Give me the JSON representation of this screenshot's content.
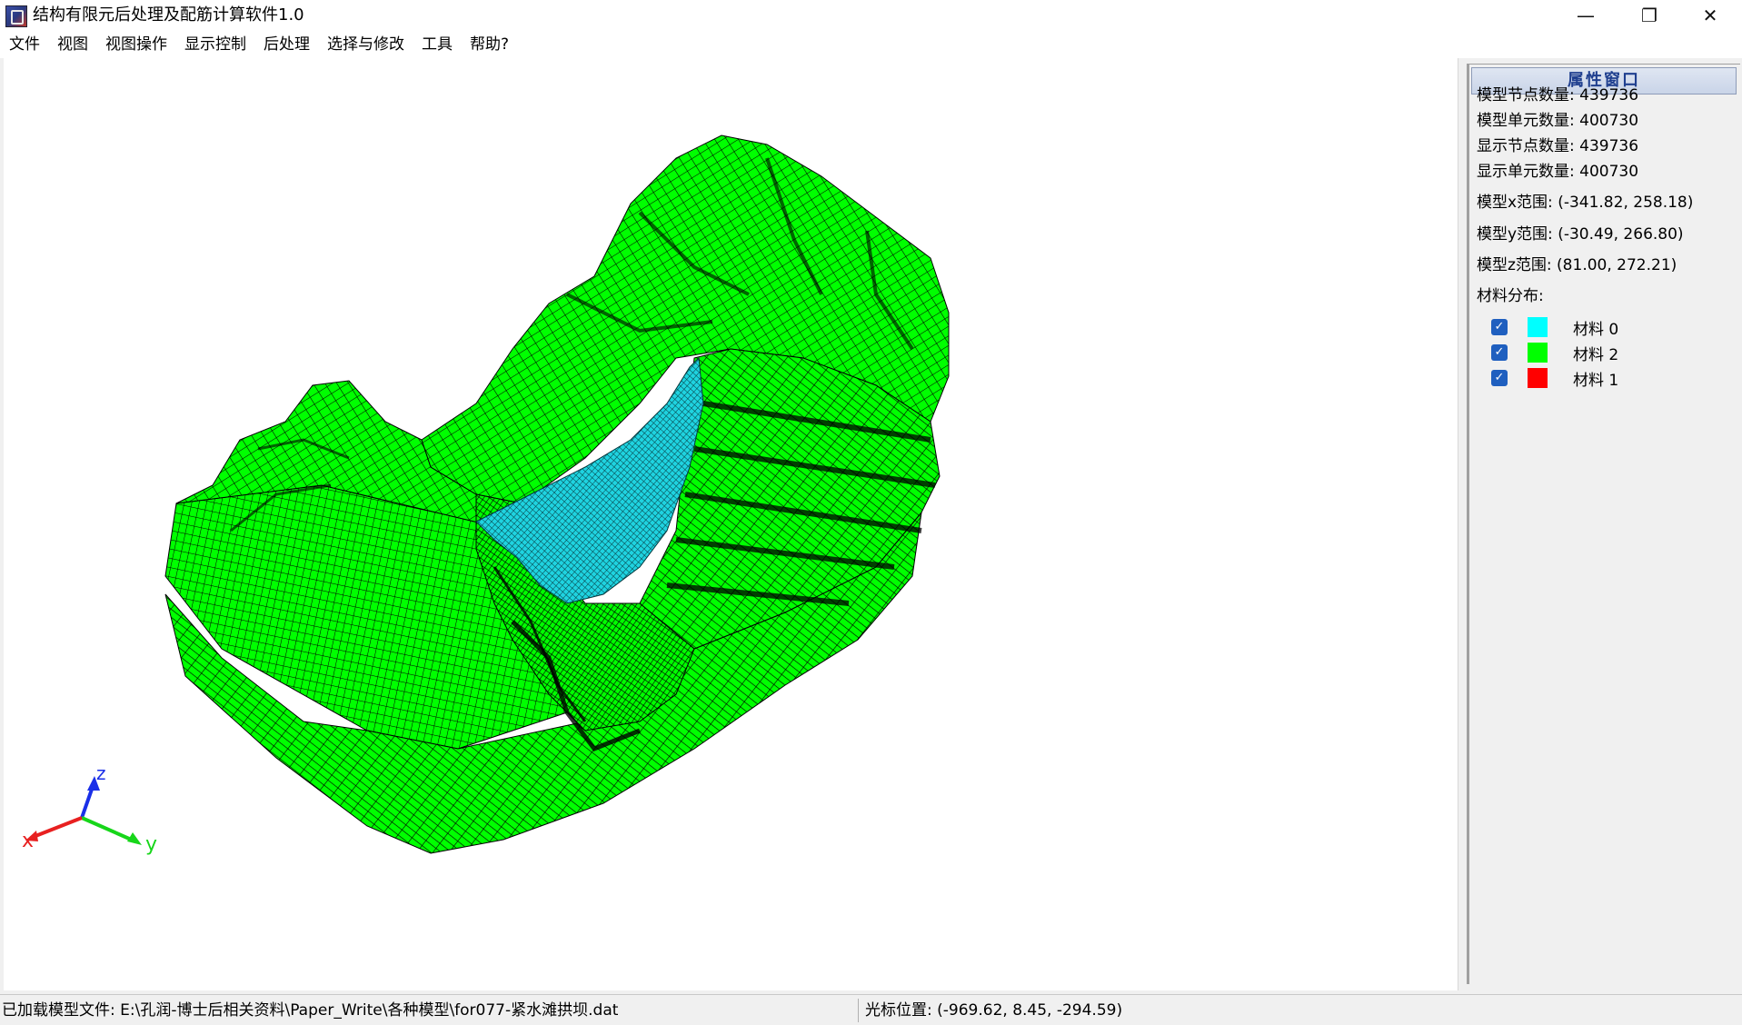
{
  "window": {
    "title": "结构有限元后处理及配筋计算软件1.0",
    "minimize_glyph": "—",
    "maximize_glyph": "❐",
    "close_glyph": "✕"
  },
  "menu": [
    "文件",
    "视图",
    "视图操作",
    "显示控制",
    "后处理",
    "选择与修改",
    "工具",
    "帮助?"
  ],
  "axes": {
    "x_label": "x",
    "y_label": "y",
    "z_label": "z"
  },
  "panel": {
    "title": "属性窗口",
    "props": [
      "模型节点数量: 439736",
      "模型单元数量: 400730",
      "显示节点数量: 439736",
      "显示单元数量: 400730",
      "模型x范围: (-341.82, 258.18)",
      "模型y范围: (-30.49, 266.80)",
      "模型z范围: (81.00, 272.21)",
      "材料分布:"
    ],
    "materials": [
      {
        "label": "材料 0",
        "color": "#00ffff",
        "checked": true
      },
      {
        "label": "材料 2",
        "color": "#00ff00",
        "checked": true
      },
      {
        "label": "材料 1",
        "color": "#ff0000",
        "checked": true
      }
    ]
  },
  "status": {
    "file": "已加载模型文件: E:\\孔润-博士后相关资料\\Paper_Write\\各种模型\\for077-紧水滩拱坝.dat",
    "cursor": "光标位置: (-969.62, 8.45, -294.59)"
  },
  "colors": {
    "mesh_green": "#00ff00",
    "dam_cyan": "#19c9d8",
    "mesh_line": "#000000"
  }
}
